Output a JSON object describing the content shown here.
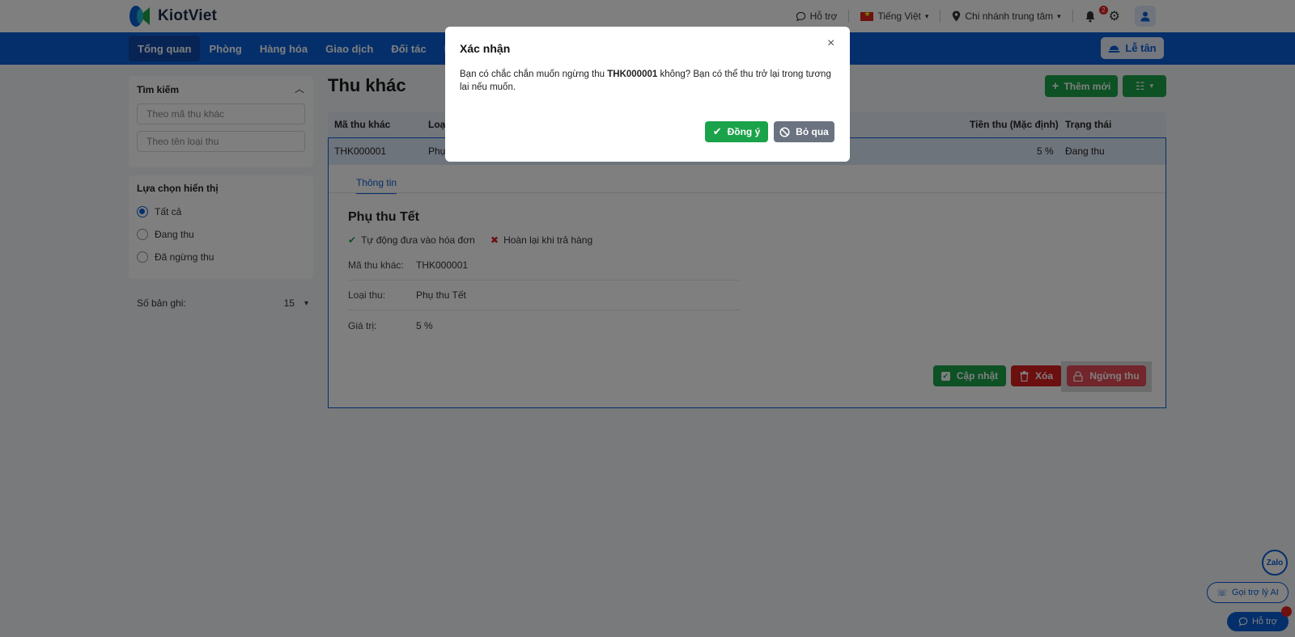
{
  "topbar": {
    "brand": "KiotViet",
    "support": "Hỗ trợ",
    "language": "Tiếng Việt",
    "branch": "Chi nhánh trung tâm",
    "notification_count": "2"
  },
  "nav": {
    "items": [
      "Tổng quan",
      "Phòng",
      "Hàng hóa",
      "Giao dịch",
      "Đối tác",
      "N"
    ],
    "reception": "Lễ tân"
  },
  "sidebar": {
    "search_title": "Tìm kiếm",
    "search_code_placeholder": "Theo mã thu khác",
    "search_name_placeholder": "Theo tên loại thu",
    "display_title": "Lựa chọn hiển thị",
    "options": [
      "Tất cả",
      "Đang thu",
      "Đã ngừng thu"
    ],
    "selected_option": "Tất cả",
    "records_label": "Số bản ghi:",
    "records_value": "15"
  },
  "main": {
    "title": "Thu khác",
    "new_button": "Thêm mới",
    "columns": [
      "Mã thu khác",
      "Loại",
      "Tiền thu (Mặc định)",
      "Trạng thái"
    ],
    "row": {
      "code": "THK000001",
      "type": "Phụ",
      "amount": "5 %",
      "status": "Đang thu"
    },
    "detail": {
      "tab": "Thông tin",
      "title": "Phụ thu Tết",
      "auto_invoice": "Tự động đưa vào hóa đơn",
      "refund_on_return": "Hoàn lại khi trả hàng",
      "fields": [
        {
          "label": "Mã thu khác:",
          "value": "THK000001"
        },
        {
          "label": "Loại thu:",
          "value": "Phụ thu Tết"
        },
        {
          "label": "Giá trị:",
          "value": "5 %"
        }
      ],
      "update_button": "Cập nhật",
      "delete_button": "Xóa",
      "stop_button": "Ngừng thu"
    }
  },
  "floating": {
    "zalo": "Zalo",
    "ai_assistant": "Gọi trợ lý AI",
    "help": "Hỗ trợ"
  },
  "modal": {
    "title": "Xác nhận",
    "message_before": "Bạn có chắc chắn muốn ngừng thu ",
    "message_code": "THK000001",
    "message_after": " không? Bạn có thể thu trở lại trong tương lai nếu muốn.",
    "confirm": "Đồng ý",
    "cancel": "Bỏ qua"
  },
  "colors": {
    "primary": "#0a5fd6",
    "success": "#1aa34a",
    "danger": "#d81e1e"
  }
}
